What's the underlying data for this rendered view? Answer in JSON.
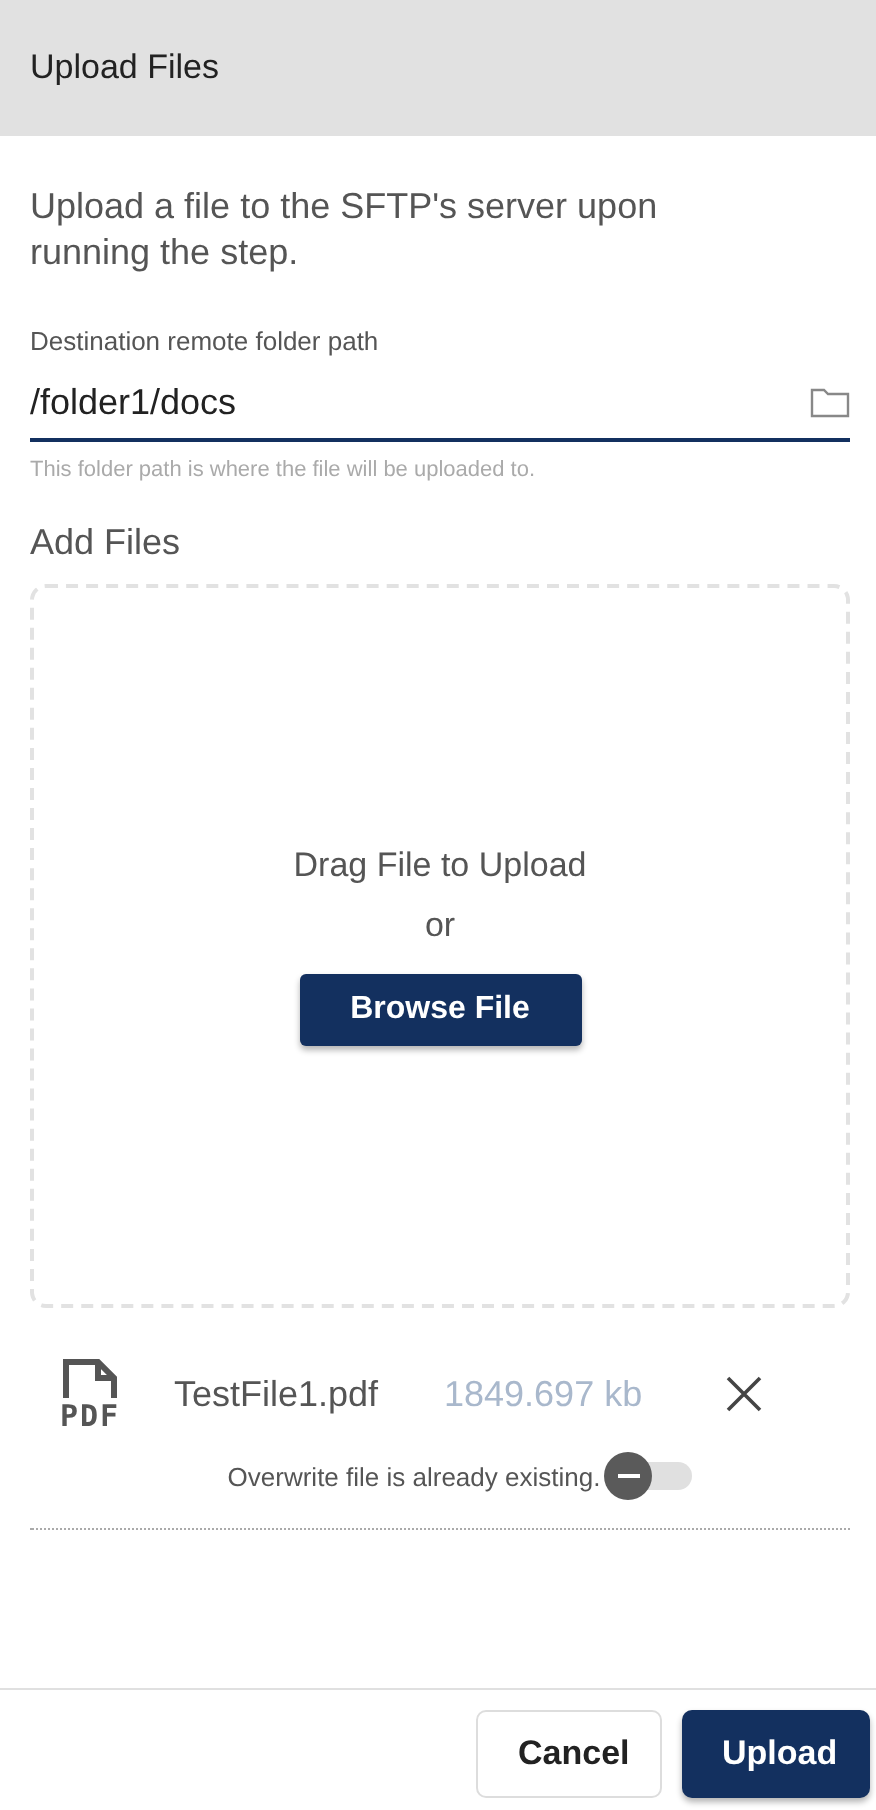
{
  "header": {
    "title": "Upload Files"
  },
  "description": "Upload a file to the SFTP's server upon running the step.",
  "folder_field": {
    "label": "Destination remote folder path",
    "value": "/folder1/docs",
    "hint": "This folder path is where the file will be uploaded to."
  },
  "add_files": {
    "title": "Add Files",
    "drop_text": "Drag File to Upload",
    "or": "or",
    "browse_button": "Browse File"
  },
  "files": [
    {
      "type_label": "PDF",
      "name": "TestFile1.pdf",
      "size": "1849.697 kb",
      "overwrite_label": "Overwrite file is already existing.",
      "overwrite": false
    }
  ],
  "buttons": [
    {
      "label": "Cancel",
      "kind": "secondary"
    },
    {
      "label": "Upload",
      "kind": "primary"
    }
  ]
}
